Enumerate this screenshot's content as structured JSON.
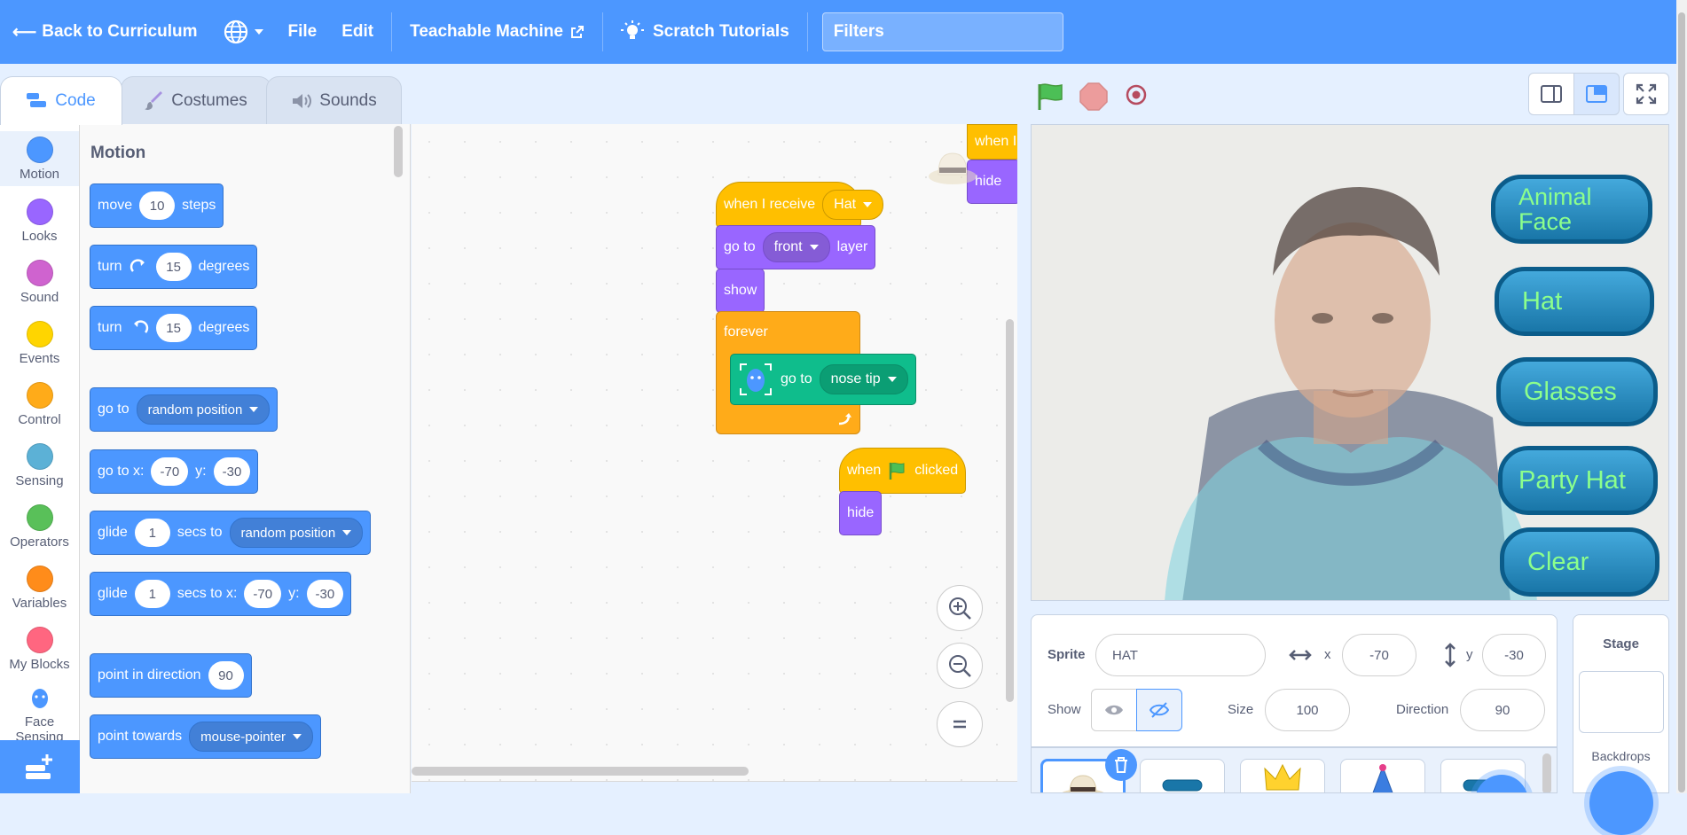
{
  "menu": {
    "back": "Back to Curriculum",
    "file": "File",
    "edit": "Edit",
    "teachable": "Teachable Machine",
    "tutorials": "Scratch Tutorials",
    "filters_placeholder": "Filters"
  },
  "tabs": {
    "code": "Code",
    "costumes": "Costumes",
    "sounds": "Sounds"
  },
  "categories": [
    {
      "label": "Motion",
      "color": "#4c97ff"
    },
    {
      "label": "Looks",
      "color": "#9966ff"
    },
    {
      "label": "Sound",
      "color": "#cf63cf"
    },
    {
      "label": "Events",
      "color": "#ffd500"
    },
    {
      "label": "Control",
      "color": "#ffab19"
    },
    {
      "label": "Sensing",
      "color": "#5cb1d6"
    },
    {
      "label": "Operators",
      "color": "#59c059"
    },
    {
      "label": "Variables",
      "color": "#ff8c1a"
    },
    {
      "label": "My Blocks",
      "color": "#ff6680"
    },
    {
      "label": "Face Sensing",
      "color": "#0fbd8c"
    }
  ],
  "palette": {
    "heading": "Motion",
    "move": {
      "a": "move",
      "n": "10",
      "b": "steps"
    },
    "turn_right": {
      "a": "turn",
      "n": "15",
      "b": "degrees"
    },
    "turn_left": {
      "a": "turn",
      "n": "15",
      "b": "degrees"
    },
    "goto": {
      "a": "go to",
      "opt": "random position"
    },
    "gotoxy": {
      "a": "go to x:",
      "x": "-70",
      "ylab": "y:",
      "y": "-30"
    },
    "glide": {
      "a": "glide",
      "n": "1",
      "b": "secs to",
      "opt": "random position"
    },
    "glidexy": {
      "a": "glide",
      "n": "1",
      "b": "secs to x:",
      "x": "-70",
      "ylab": "y:",
      "y": "-30"
    },
    "point_dir": {
      "a": "point in direction",
      "n": "90"
    },
    "point_towards": {
      "a": "point towards",
      "opt": "mouse-pointer"
    }
  },
  "scripts": {
    "s1": {
      "when_receive": "when I receive",
      "msg": "Hat",
      "goto": "go to",
      "layer_opt": "front",
      "layer": "layer",
      "show": "show",
      "forever": "forever",
      "fs_goto": "go to",
      "fs_opt": "nose tip"
    },
    "s2": {
      "when": "when",
      "clicked": "clicked",
      "hide": "hide"
    },
    "s3": {
      "when_partial": "when I",
      "hide": "hide"
    }
  },
  "sprite": {
    "label": "Sprite",
    "name": "HAT",
    "x_label": "x",
    "x": "-70",
    "y_label": "y",
    "y": "-30",
    "show_label": "Show",
    "size_label": "Size",
    "size": "100",
    "dir_label": "Direction",
    "direction": "90"
  },
  "stage_panel": {
    "title": "Stage",
    "backdrops": "Backdrops"
  },
  "stage_buttons": [
    "Animal Face",
    "Hat",
    "Glasses",
    "Party Hat",
    "Clear"
  ],
  "colors": {
    "accent": "#4c97ff",
    "events": "#ffbf00",
    "looks": "#9966ff",
    "control": "#ffab19",
    "face_sensing": "#0fbd8c"
  }
}
